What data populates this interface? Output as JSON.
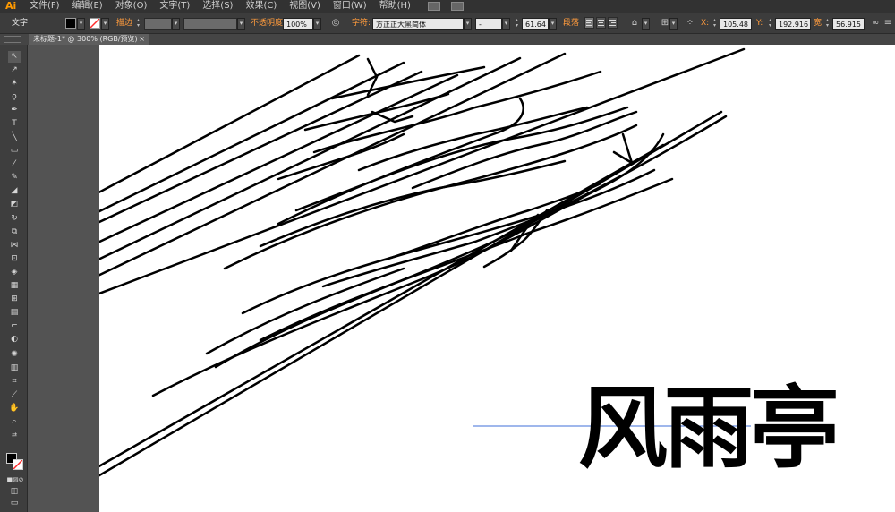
{
  "app": {
    "logo": "Ai"
  },
  "menu": [
    "文件(F)",
    "编辑(E)",
    "对象(O)",
    "文字(T)",
    "选择(S)",
    "效果(C)",
    "视图(V)",
    "窗口(W)",
    "帮助(H)"
  ],
  "control_bar": {
    "mode_label": "文字",
    "stroke_label": "描边",
    "opacity_label": "不透明度",
    "opacity_value": "100%",
    "char_label": "字符:",
    "font_family": "方正正大黑简体",
    "font_style": "-",
    "font_size": "61.64",
    "paragraph_label": "段落",
    "x_value": "105.48",
    "y_value": "192.916",
    "w_label": "宽:",
    "w_value": "56.915",
    "fill_color": "#000000",
    "stroke_none_color": "#ff2a2a"
  },
  "document": {
    "tab_title": "未标题-1* @ 300% (RGB/预览)"
  },
  "artwork": {
    "text": "风雨亭",
    "stroke_color": "#000000",
    "baseline_color": "#3f6fd8"
  }
}
